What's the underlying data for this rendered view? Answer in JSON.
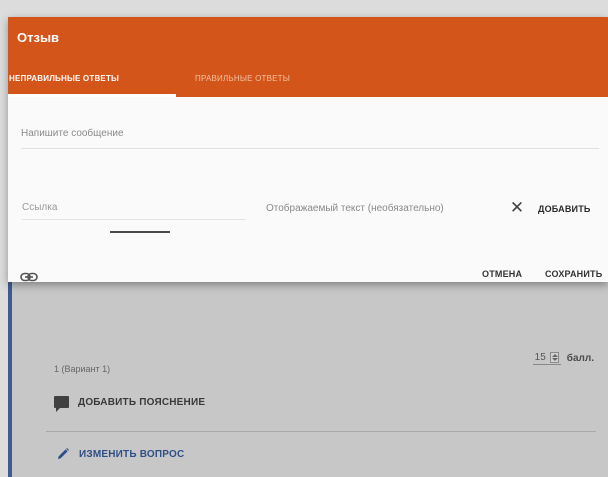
{
  "dialog": {
    "title": "Отзыв",
    "tabs": [
      {
        "label": "НЕПРАВИЛЬНЫЕ ОТВЕТЫ",
        "active": true
      },
      {
        "label": "ПРАВИЛЬНЫЕ ОТВЕТЫ",
        "active": false
      }
    ],
    "message_placeholder": "Напишите сообщение",
    "link_placeholder": "Ссылка",
    "display_text_placeholder": "Отображаемый текст (необязательно)",
    "add_label": "ДОБАВИТЬ",
    "cancel_label": "ОТМЕНА",
    "save_label": "СОХРАНИТЬ",
    "icons": {
      "clear": "close-icon",
      "link": "link-icon"
    }
  },
  "question": {
    "points_value": "15",
    "points_unit": "балл.",
    "option_text": "1 (Вариант 1)",
    "add_explanation_label": "ДОБАВИТЬ ПОЯСНЕНИЕ",
    "edit_question_label": "ИЗМЕНИТЬ ВОПРОС",
    "icons": {
      "explanation": "comment-icon",
      "edit": "pencil-icon",
      "spinner": "spinner-icon"
    }
  },
  "colors": {
    "header": "#d3551a",
    "accent_blue": "#2f4f86",
    "card_border": "#3f5c8f"
  }
}
